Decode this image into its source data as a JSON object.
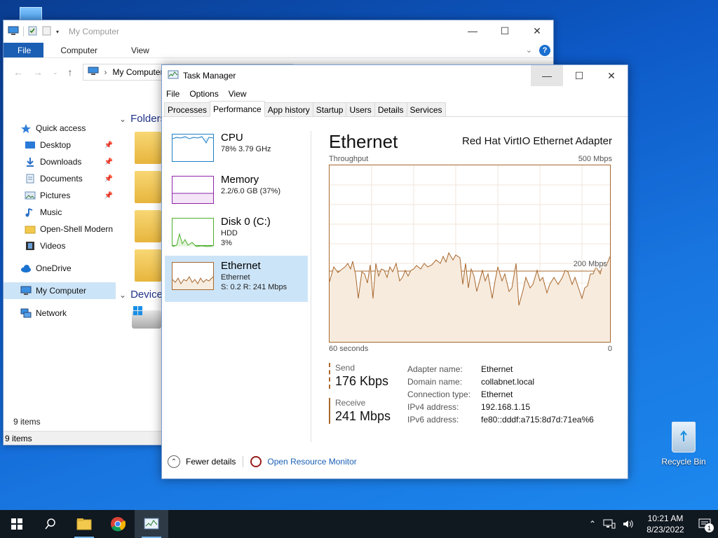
{
  "colors": {
    "accent_blue": "#1a5fb4",
    "ethernet_line": "#a8682d",
    "cpu_line": "#1e7fc4",
    "memory_line": "#8e24aa",
    "disk_line": "#4caf2a",
    "selected_bg": "#cce4f7"
  },
  "explorer": {
    "title": "My Computer",
    "ribbon_tabs": [
      "File",
      "Computer",
      "View"
    ],
    "address": "My Computer",
    "nav": [
      {
        "label": "Quick access",
        "icon": "star-icon"
      },
      {
        "label": "Desktop",
        "icon": "desktop-icon",
        "pinned": true
      },
      {
        "label": "Downloads",
        "icon": "download-arrow-icon",
        "pinned": true
      },
      {
        "label": "Documents",
        "icon": "document-icon",
        "pinned": true
      },
      {
        "label": "Pictures",
        "icon": "pictures-icon",
        "pinned": true
      },
      {
        "label": "Music",
        "icon": "music-note-icon"
      },
      {
        "label": "Open-Shell Modern",
        "icon": "folder-icon"
      },
      {
        "label": "Videos",
        "icon": "film-icon"
      },
      {
        "label": "OneDrive",
        "icon": "cloud-icon"
      },
      {
        "label": "My Computer",
        "icon": "computer-icon"
      },
      {
        "label": "Network",
        "icon": "network-icon"
      }
    ],
    "group_folders": "Folders",
    "group_devices": "Device",
    "status_items_top": "9 items",
    "status_items_bottom": "9 items"
  },
  "taskmanager": {
    "title": "Task Manager",
    "menu": [
      "File",
      "Options",
      "View"
    ],
    "tabs": [
      "Processes",
      "Performance",
      "App history",
      "Startup",
      "Users",
      "Details",
      "Services"
    ],
    "active_tab": "Performance",
    "side": [
      {
        "name": "CPU",
        "line1": "78%  3.79 GHz",
        "line2": ""
      },
      {
        "name": "Memory",
        "line1": "2.2/6.0 GB (37%)",
        "line2": ""
      },
      {
        "name": "Disk 0 (C:)",
        "line1": "HDD",
        "line2": "3%"
      },
      {
        "name": "Ethernet",
        "line1": "Ethernet",
        "line2": "S: 0.2  R: 241 Mbps"
      }
    ],
    "detail": {
      "title": "Ethernet",
      "adapter": "Red Hat VirtIO Ethernet Adapter",
      "graph_label": "Throughput",
      "graph_max": "500 Mbps",
      "graph_mid": "200 Mbps",
      "graph_time": "60 seconds",
      "graph_zero": "0",
      "send_label": "Send",
      "send_value": "176 Kbps",
      "receive_label": "Receive",
      "receive_value": "241 Mbps",
      "props": [
        {
          "k": "Adapter name:",
          "v": "Ethernet"
        },
        {
          "k": "Domain name:",
          "v": "collabnet.local"
        },
        {
          "k": "Connection type:",
          "v": "Ethernet"
        },
        {
          "k": "IPv4 address:",
          "v": "192.168.1.15"
        },
        {
          "k": "IPv6 address:",
          "v": "fe80::dddf:a715:8d7d:71ea%6"
        }
      ]
    },
    "footer": {
      "fewer": "Fewer details",
      "resmon": "Open Resource Monitor"
    }
  },
  "desktop": {
    "recycle_bin": "Recycle Bin"
  },
  "taskbar": {
    "time": "10:21 AM",
    "date": "8/23/2022",
    "notifications": "1"
  }
}
